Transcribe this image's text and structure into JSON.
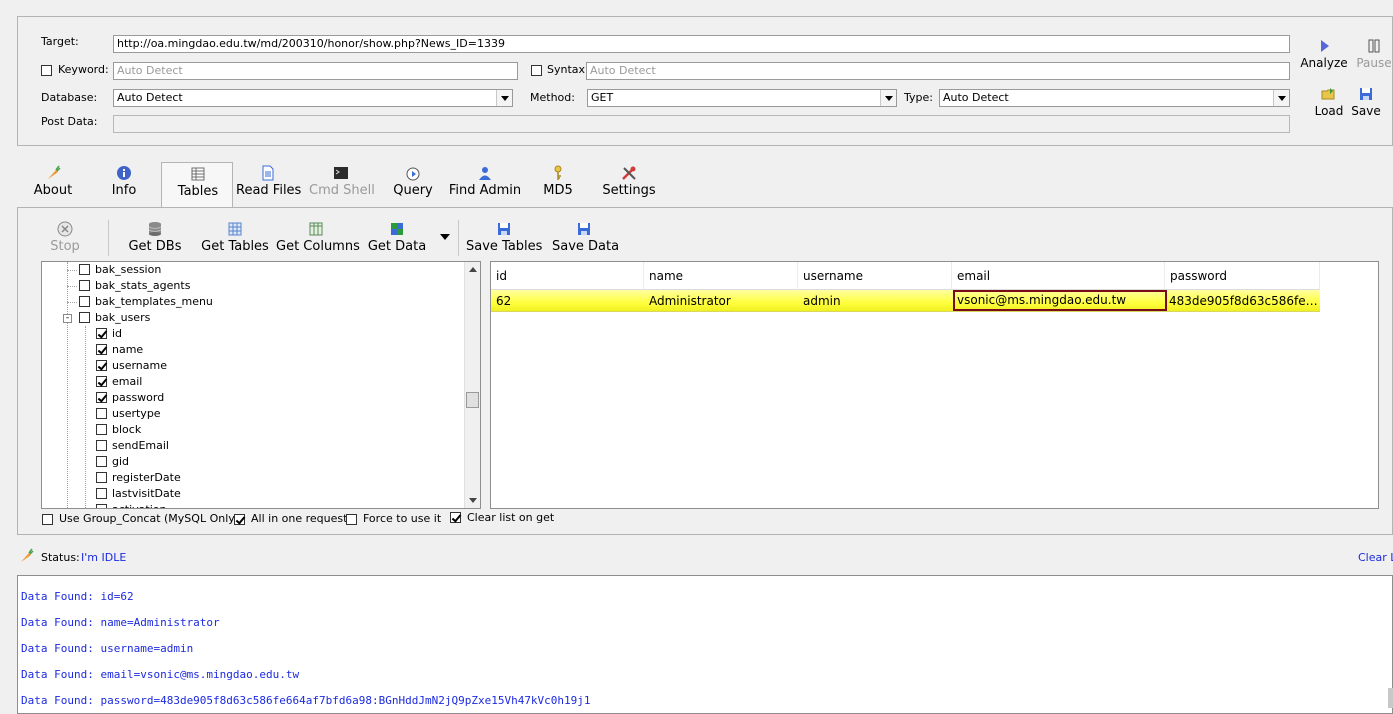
{
  "form": {
    "target_label": "Target:",
    "target_value": "http://oa.mingdao.edu.tw/md/200310/honor/show.php?News_ID=1339",
    "keyword_label": "Keyword:",
    "keyword_placeholder": "Auto Detect",
    "syntax_label": "Syntax:",
    "syntax_placeholder": "Auto Detect",
    "database_label": "Database:",
    "database_value": "Auto Detect",
    "method_label": "Method:",
    "method_value": "GET",
    "type_label": "Type:",
    "type_value": "Auto Detect",
    "postdata_label": "Post Data:"
  },
  "actions": {
    "analyze": "Analyze",
    "pause": "Pause",
    "load": "Load",
    "save": "Save"
  },
  "tabs": [
    {
      "label": "About",
      "icon": "carrot-icon"
    },
    {
      "label": "Info",
      "icon": "info-icon"
    },
    {
      "label": "Tables",
      "icon": "table-icon"
    },
    {
      "label": "Read Files",
      "icon": "document-icon"
    },
    {
      "label": "Cmd Shell",
      "icon": "terminal-icon"
    },
    {
      "label": "Query",
      "icon": "query-icon"
    },
    {
      "label": "Find Admin",
      "icon": "user-icon"
    },
    {
      "label": "MD5",
      "icon": "key-icon"
    },
    {
      "label": "Settings",
      "icon": "tools-icon"
    }
  ],
  "toolbar": {
    "stop": "Stop",
    "get_dbs": "Get DBs",
    "get_tables": "Get Tables",
    "get_columns": "Get Columns",
    "get_data": "Get Data",
    "save_tables": "Save Tables",
    "save_data": "Save Data"
  },
  "tree": {
    "items": [
      {
        "label": "bak_session",
        "checked": false
      },
      {
        "label": "bak_stats_agents",
        "checked": false
      },
      {
        "label": "bak_templates_menu",
        "checked": false
      },
      {
        "label": "bak_users",
        "checked": false
      },
      {
        "label": "id",
        "checked": true
      },
      {
        "label": "name",
        "checked": true
      },
      {
        "label": "username",
        "checked": true
      },
      {
        "label": "email",
        "checked": true
      },
      {
        "label": "password",
        "checked": true
      },
      {
        "label": "usertype",
        "checked": false
      },
      {
        "label": "block",
        "checked": false
      },
      {
        "label": "sendEmail",
        "checked": false
      },
      {
        "label": "gid",
        "checked": false
      },
      {
        "label": "registerDate",
        "checked": false
      },
      {
        "label": "lastvisitDate",
        "checked": false
      },
      {
        "label": "activation",
        "checked": false
      }
    ]
  },
  "grid": {
    "columns": [
      "id",
      "name",
      "username",
      "email",
      "password"
    ],
    "row": [
      "62",
      "Administrator",
      "admin",
      "vsonic@ms.mingdao.edu.tw",
      "483de905f8d63c586fe6..."
    ]
  },
  "options": {
    "group_concat": "Use Group_Concat (MySQL Only)",
    "all_in_one": "All in one request.",
    "force": "Force to use it",
    "clear_list": "Clear list on get"
  },
  "status": {
    "label": "Status:",
    "value": "I'm IDLE",
    "clear": "Clear L"
  },
  "log": [
    "Data Found: id=62",
    "Data Found: name=Administrator",
    "Data Found: username=admin",
    "Data Found: email=vsonic@ms.mingdao.edu.tw",
    "Data Found: password=483de905f8d63c586fe664af7bfd6a98:BGnHddJmN2jQ9pZxe15Vh47kVc0h19j1"
  ],
  "colors": {
    "row_highlight": "#ffff60",
    "selected_cell_border": "#7a0c1a",
    "log_text": "#1c2ae0",
    "status_value": "#1c2ae0"
  }
}
